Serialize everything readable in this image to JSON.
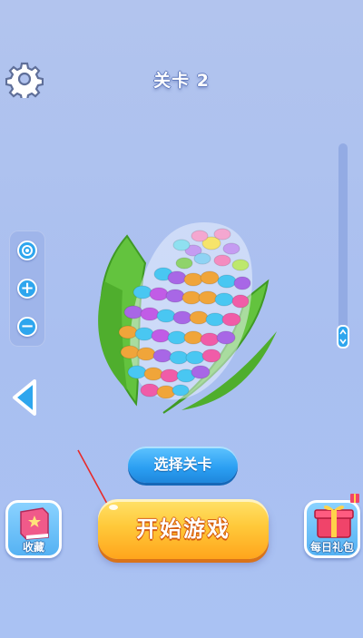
{
  "header": {
    "level_title": "关卡 2",
    "settings_icon": "gear-icon"
  },
  "zoom_controls": {
    "items": [
      {
        "icon": "target-icon"
      },
      {
        "icon": "plus-icon",
        "glyph": "+"
      },
      {
        "icon": "minus-icon",
        "glyph": "−"
      }
    ]
  },
  "navigation": {
    "back_icon": "left-arrow-icon"
  },
  "scrollbar": {
    "thumb_icon": "updown-arrows-icon"
  },
  "puzzle": {
    "object": "corn-icon"
  },
  "buttons": {
    "select_level": "选择关卡",
    "start_game": "开始游戏"
  },
  "side_buttons": {
    "collection_label": "收藏",
    "collection_icon": "book-icon",
    "daily_gift_label": "每日礼包",
    "daily_gift_icon": "gift-icon"
  },
  "colors": {
    "background": "#aac0f0",
    "primary_blue": "#2ea6ee",
    "start_orange": "#ffb42a"
  }
}
